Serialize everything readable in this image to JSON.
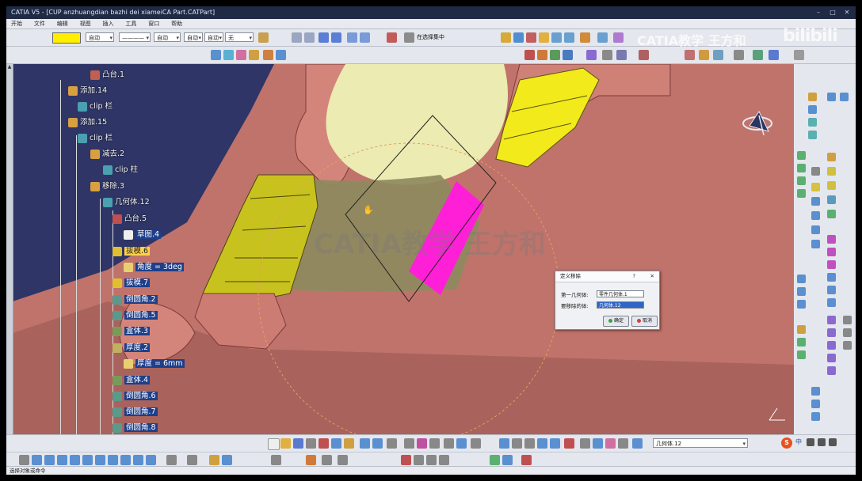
{
  "window": {
    "title": "CATIA V5 - [CUP anzhuangdian bazhi dei xiameiCA Part.CATPart]",
    "min": "–",
    "max": "□",
    "close": "✕"
  },
  "menu": [
    "开始",
    "文件",
    "编辑",
    "视图",
    "插入",
    "工具",
    "窗口",
    "帮助"
  ],
  "toolbar": {
    "fill_color": "#ffee00",
    "transparency_combo": "自动",
    "line_combo": "————",
    "thickness_combo": "自动",
    "layer_combo": "自动",
    "layer2_combo": "自动",
    "none_combo": "无",
    "snap_label": "在选择集中",
    "workbench_combo": "几何体.12"
  },
  "watermark": {
    "channel": "CATIA教学 王方和",
    "platform": "bilibili",
    "center": "CATIA教学 王方和"
  },
  "tree": [
    {
      "label": "凸台.1",
      "depth": 4,
      "icon": "pad-icon",
      "state": ""
    },
    {
      "label": "添加.14",
      "depth": 3,
      "icon": "add-icon",
      "state": ""
    },
    {
      "label": "clip 栏",
      "depth": 4,
      "icon": "body-icon",
      "state": ""
    },
    {
      "label": "添加.15",
      "depth": 3,
      "icon": "add-icon",
      "state": ""
    },
    {
      "label": "clip 栏",
      "depth": 4,
      "icon": "body-icon",
      "state": ""
    },
    {
      "label": "减去.2",
      "depth": 5,
      "icon": "remove-icon",
      "state": ""
    },
    {
      "label": "clip 柱",
      "depth": 6,
      "icon": "body-icon",
      "state": ""
    },
    {
      "label": "移除.3",
      "depth": 5,
      "icon": "remove-icon",
      "state": ""
    },
    {
      "label": "几何体.12",
      "depth": 6,
      "icon": "body-icon",
      "state": ""
    },
    {
      "label": "凸台.5",
      "depth": 7,
      "icon": "pad-icon",
      "state": ""
    },
    {
      "label": "草图.4",
      "depth": 8,
      "icon": "sketch-icon",
      "state": "hl"
    },
    {
      "label": "拔模.6",
      "depth": 7,
      "icon": "draft-icon",
      "state": "sel"
    },
    {
      "label": "角度 = 3deg",
      "depth": 8,
      "icon": "param-icon",
      "state": "hl"
    },
    {
      "label": "拔模.7",
      "depth": 7,
      "icon": "draft-icon",
      "state": "hl"
    },
    {
      "label": "倒圆角.2",
      "depth": 7,
      "icon": "fillet-icon",
      "state": "hl"
    },
    {
      "label": "倒圆角.5",
      "depth": 7,
      "icon": "fillet-icon",
      "state": "hl"
    },
    {
      "label": "盒体.3",
      "depth": 7,
      "icon": "shell-icon",
      "state": "hl"
    },
    {
      "label": "厚度.2",
      "depth": 7,
      "icon": "thickness-icon",
      "state": "hl"
    },
    {
      "label": "厚度 = 6mm",
      "depth": 8,
      "icon": "param-icon",
      "state": "hl"
    },
    {
      "label": "盒体.4",
      "depth": 7,
      "icon": "shell-icon",
      "state": "hl"
    },
    {
      "label": "倒圆角.6",
      "depth": 7,
      "icon": "fillet-icon",
      "state": "hl"
    },
    {
      "label": "倒圆角.7",
      "depth": 7,
      "icon": "fillet-icon",
      "state": "hl"
    },
    {
      "label": "倒圆角.8",
      "depth": 7,
      "icon": "fillet-icon",
      "state": "hl"
    }
  ],
  "dialog": {
    "title": "定义移除",
    "help": "?",
    "close": "✕",
    "field1_label": "第一几何体:",
    "field1_value": "零件几何体.1",
    "field2_label": "要移除的体:",
    "field2_value": "几何体.12",
    "ok": "确定",
    "cancel": "取消"
  },
  "status": {
    "text": "选择对象或命令"
  },
  "ime": {
    "s_logo": "S",
    "lang": "中"
  }
}
